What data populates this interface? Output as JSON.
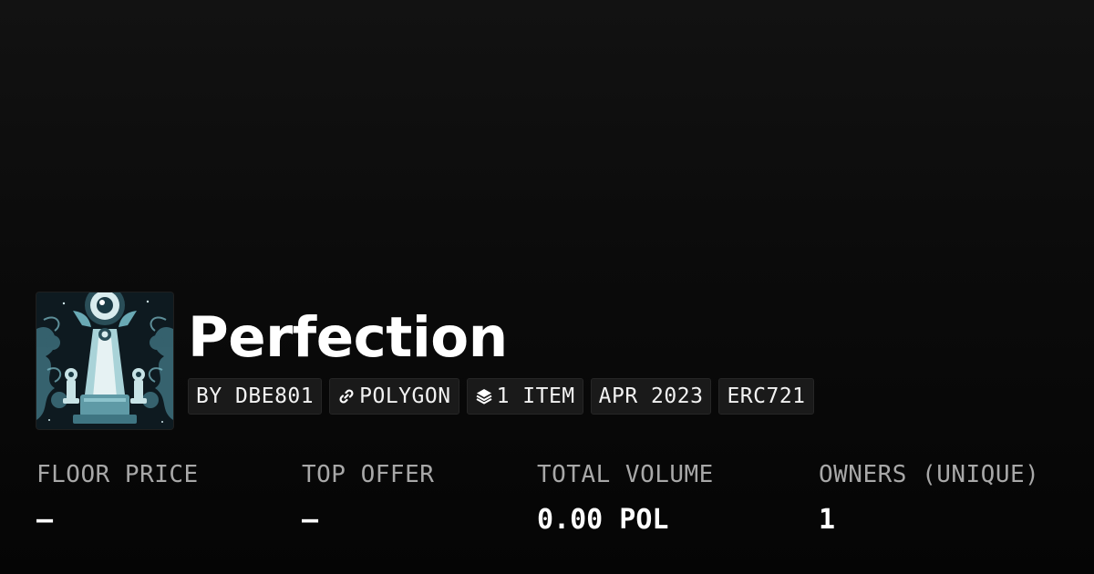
{
  "collection": {
    "name": "Perfection",
    "image_icon": "eye-pyramid-artwork"
  },
  "badges": {
    "creator": "BY DBE801",
    "chain": "POLYGON",
    "chain_icon": "link-icon",
    "items": "1 ITEM",
    "items_icon": "layers-icon",
    "created": "APR 2023",
    "standard": "ERC721"
  },
  "stats": [
    {
      "label": "FLOOR PRICE",
      "value": "–"
    },
    {
      "label": "TOP OFFER",
      "value": "–"
    },
    {
      "label": "TOTAL VOLUME",
      "value": "0.00 POL"
    },
    {
      "label": "OWNERS (UNIQUE)",
      "value": "1"
    }
  ],
  "colors": {
    "background": "#0b0b0b",
    "badge_bg": "#1a1a1a",
    "label": "#a8a8a8",
    "artwork_teal": "#5fa3b0"
  }
}
